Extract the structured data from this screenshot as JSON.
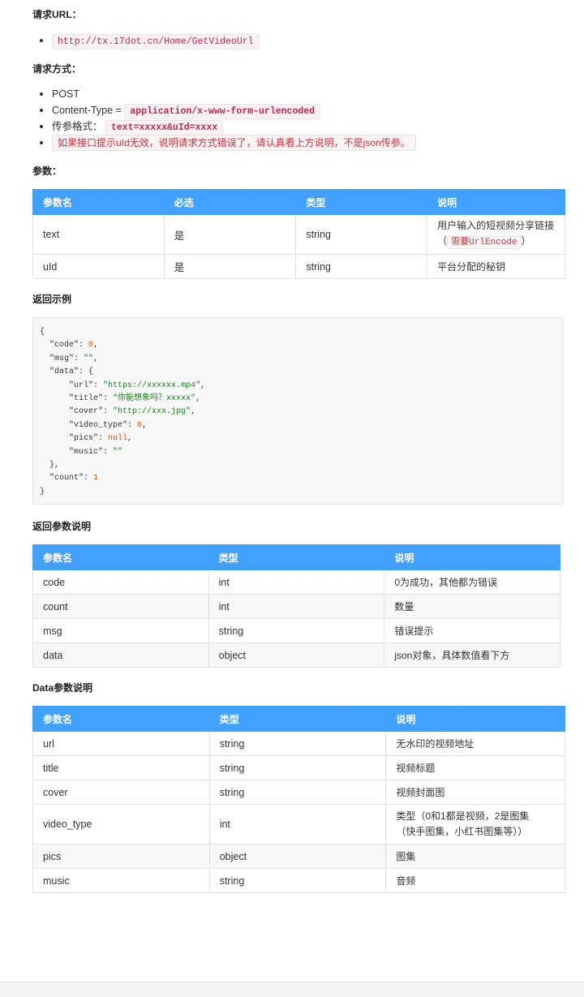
{
  "sections": {
    "request_url_heading": "请求URL：",
    "request_method_heading": "请求方式：",
    "params_heading": "参数：",
    "return_example_heading": "返回示例",
    "return_params_heading": "返回参数说明",
    "data_params_heading": "Data参数说明"
  },
  "request_url": "http://tx.17dot.cn/Home/GetVideoUrl",
  "method": {
    "post": "POST",
    "content_type_label": "Content-Type =",
    "content_type_value": "application/x-www-form-urlencoded",
    "format_label": "传参格式：",
    "format_value": "text=xxxxx&uId=xxxx",
    "warning": "如果接口提示uId无效，说明请求方式错误了，请认真看上方说明，不是json传参。"
  },
  "params_table": {
    "headers": [
      "参数名",
      "必选",
      "类型",
      "说明"
    ],
    "rows": [
      {
        "name": "text",
        "required": "是",
        "type": "string",
        "desc_text": "用户输入的短视频分享链接",
        "desc_open": "（",
        "desc_code": "需要UrlEncode",
        "desc_close": "）"
      },
      {
        "name": "uId",
        "required": "是",
        "type": "string",
        "desc": "平台分配的秘钥"
      }
    ]
  },
  "return_example": {
    "open": "{",
    "code_key": "\"code\"",
    "code_val": "0",
    "msg_key": "\"msg\"",
    "msg_val": "\"\"",
    "data_key": "\"data\"",
    "data_open": "{",
    "url_key": "\"url\"",
    "url_val": "\"https://xxxxxx.mp4\"",
    "title_key": "\"title\"",
    "title_val": "\"你能想象吗？xxxxx\"",
    "cover_key": "\"cover\"",
    "cover_val": "\"http://xxx.jpg\"",
    "video_type_key": "\"video_type\"",
    "video_type_val": "0",
    "pics_key": "\"pics\"",
    "pics_val": "null",
    "music_key": "\"music\"",
    "music_val": "\"\"",
    "data_close": "},",
    "count_key": "\"count\"",
    "count_val": "1",
    "close": "}"
  },
  "return_table": {
    "headers": [
      "参数名",
      "类型",
      "说明"
    ],
    "rows": [
      {
        "name": "code",
        "type": "int",
        "desc": "0为成功，其他都为错误"
      },
      {
        "name": "count",
        "type": "int",
        "desc": "数量"
      },
      {
        "name": "msg",
        "type": "string",
        "desc": "错误提示"
      },
      {
        "name": "data",
        "type": "object",
        "desc": "json对象，具体数值看下方"
      }
    ]
  },
  "data_table": {
    "headers": [
      "参数名",
      "类型",
      "说明"
    ],
    "rows": [
      {
        "name": "url",
        "type": "string",
        "desc": "无水印的视频地址"
      },
      {
        "name": "title",
        "type": "string",
        "desc": "视频标题"
      },
      {
        "name": "cover",
        "type": "string",
        "desc": "视频封面图"
      },
      {
        "name": "video_type",
        "type": "int",
        "desc_line1": "类型（0和1都是视频，2是图集",
        "desc_line2": "（快手图集，小红书图集等））"
      },
      {
        "name": "pics",
        "type": "object",
        "desc": "图集"
      },
      {
        "name": "music",
        "type": "string",
        "desc": "音频"
      }
    ]
  }
}
